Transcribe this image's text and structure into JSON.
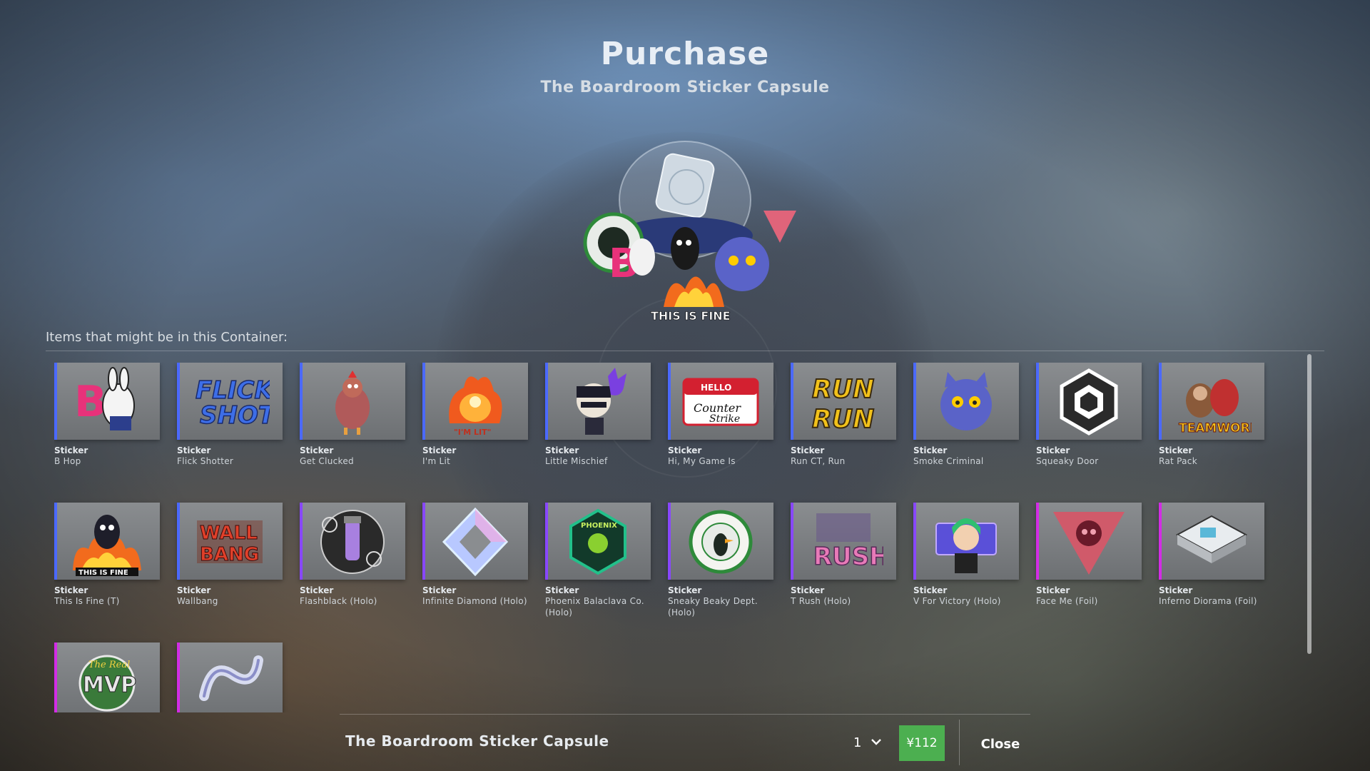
{
  "header": {
    "title": "Purchase",
    "subtitle": "The Boardroom Sticker Capsule"
  },
  "items_label": "Items that might be in this Container:",
  "rarity_colors": {
    "high_grade": "#4b69ff",
    "remarkable": "#8847ff",
    "exotic": "#d32ce6"
  },
  "items": [
    {
      "kind": "Sticker",
      "name": "B Hop",
      "rarity": "high_grade",
      "icon": "bunny-b-hop-icon"
    },
    {
      "kind": "Sticker",
      "name": "Flick Shotter",
      "rarity": "high_grade",
      "icon": "flick-shot-text-icon"
    },
    {
      "kind": "Sticker",
      "name": "Get Clucked",
      "rarity": "high_grade",
      "icon": "chicken-icon"
    },
    {
      "kind": "Sticker",
      "name": "I'm Lit",
      "rarity": "high_grade",
      "icon": "flaming-chicken-icon"
    },
    {
      "kind": "Sticker",
      "name": "Little Mischief",
      "rarity": "high_grade",
      "icon": "masked-character-icon"
    },
    {
      "kind": "Sticker",
      "name": "Hi, My Game Is",
      "rarity": "high_grade",
      "icon": "name-tag-icon"
    },
    {
      "kind": "Sticker",
      "name": "Run CT, Run",
      "rarity": "high_grade",
      "icon": "run-text-icon"
    },
    {
      "kind": "Sticker",
      "name": "Smoke Criminal",
      "rarity": "high_grade",
      "icon": "smoke-cat-icon"
    },
    {
      "kind": "Sticker",
      "name": "Squeaky Door",
      "rarity": "high_grade",
      "icon": "hexagon-logo-icon"
    },
    {
      "kind": "Sticker",
      "name": "Rat Pack",
      "rarity": "high_grade",
      "icon": "teamwork-rats-icon"
    },
    {
      "kind": "Sticker",
      "name": "This Is Fine (T)",
      "rarity": "high_grade",
      "icon": "this-is-fine-icon"
    },
    {
      "kind": "Sticker",
      "name": "Wallbang",
      "rarity": "high_grade",
      "icon": "wallbang-text-icon"
    },
    {
      "kind": "Sticker",
      "name": "Flashblack (Holo)",
      "rarity": "remarkable",
      "icon": "flashbang-icon"
    },
    {
      "kind": "Sticker",
      "name": "Infinite Diamond (Holo)",
      "rarity": "remarkable",
      "icon": "diamond-icon"
    },
    {
      "kind": "Sticker",
      "name": "Phoenix Balaclava Co. (Holo)",
      "rarity": "remarkable",
      "icon": "phoenix-badge-icon"
    },
    {
      "kind": "Sticker",
      "name": "Sneaky Beaky Dept. (Holo)",
      "rarity": "remarkable",
      "icon": "duck-badge-icon"
    },
    {
      "kind": "Sticker",
      "name": "T Rush (Holo)",
      "rarity": "remarkable",
      "icon": "rush-text-icon"
    },
    {
      "kind": "Sticker",
      "name": "V For Victory (Holo)",
      "rarity": "remarkable",
      "icon": "victory-girl-icon"
    },
    {
      "kind": "Sticker",
      "name": "Face Me (Foil)",
      "rarity": "exotic",
      "icon": "triangle-face-icon"
    },
    {
      "kind": "Sticker",
      "name": "Inferno Diorama (Foil)",
      "rarity": "exotic",
      "icon": "diorama-icon"
    },
    {
      "kind": "",
      "name": "",
      "rarity": "exotic",
      "icon": "real-mvp-icon"
    },
    {
      "kind": "",
      "name": "",
      "rarity": "exotic",
      "icon": "chrome-knot-icon"
    }
  ],
  "footer": {
    "item_name": "The Boardroom Sticker Capsule",
    "quantity": "1",
    "price": "¥112",
    "close_label": "Close"
  }
}
